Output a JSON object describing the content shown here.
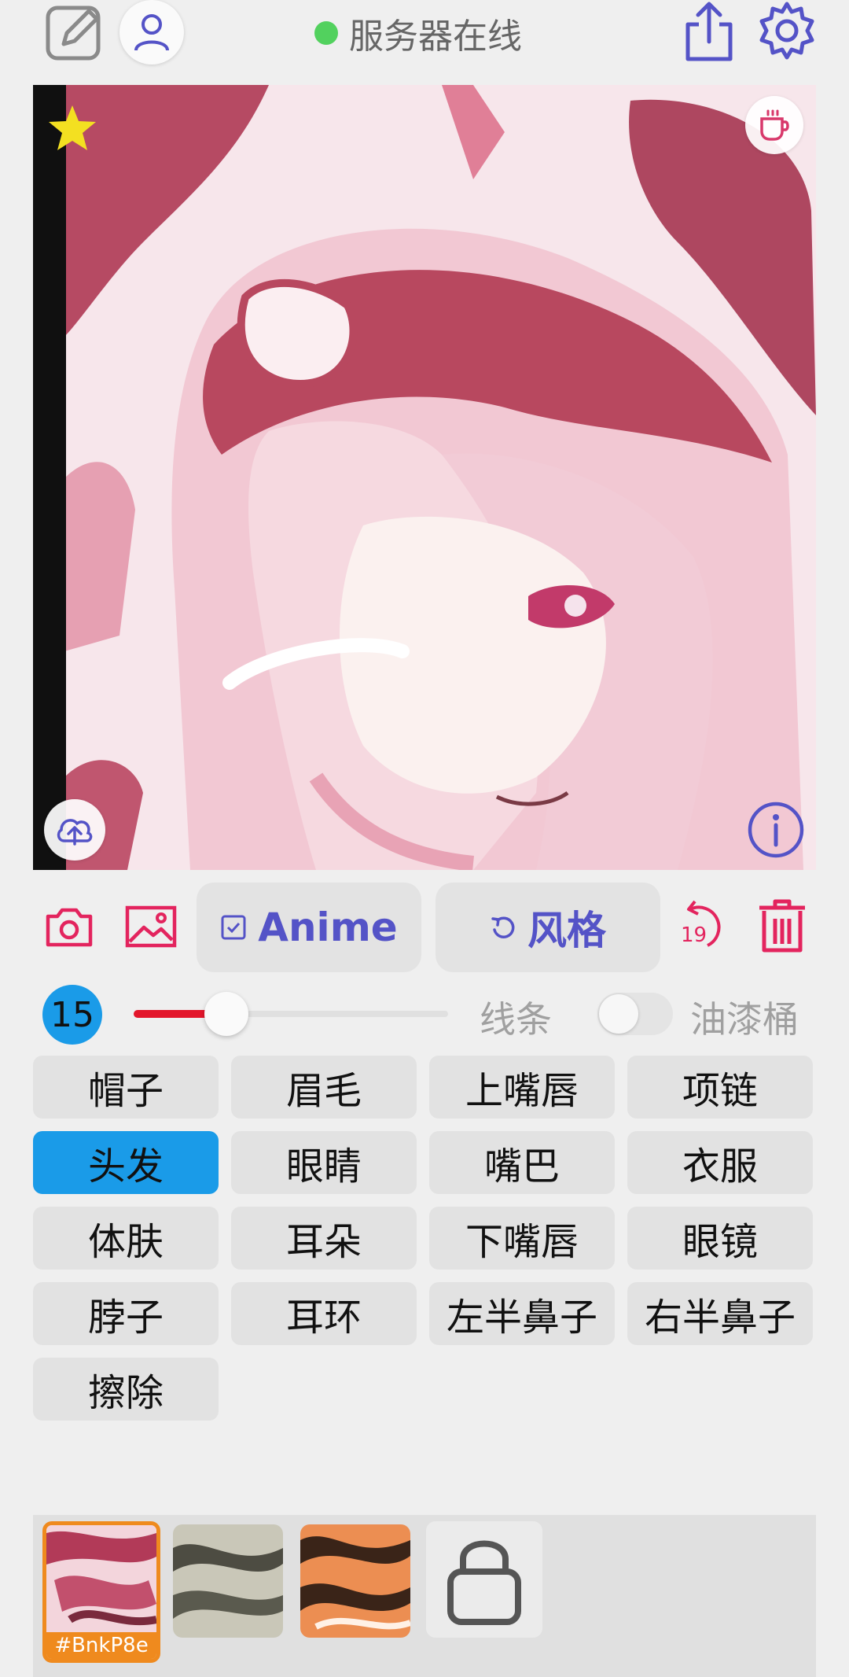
{
  "topbar": {
    "status_text": "服务器在线",
    "status_color": "#52d15e",
    "icons": [
      "edit-icon",
      "user-icon",
      "share-icon",
      "settings-icon"
    ]
  },
  "canvas": {
    "icons": [
      "star-icon",
      "coffee-cup-icon",
      "upload-cloud-icon",
      "info-icon"
    ]
  },
  "toolbar": {
    "icons": [
      "camera-icon",
      "image-icon",
      "undo-icon",
      "trash-icon"
    ],
    "anime_label": "Anime",
    "style_label": "风格",
    "undo_count": "19"
  },
  "brush": {
    "size": "15",
    "slider_fraction": 0.3,
    "line_label": "线条",
    "bucket_label": "油漆桶",
    "bucket_enabled": false
  },
  "parts": [
    {
      "label": "帽子"
    },
    {
      "label": "眉毛"
    },
    {
      "label": "上嘴唇"
    },
    {
      "label": "项链"
    },
    {
      "label": "头发",
      "selected": true
    },
    {
      "label": "眼睛"
    },
    {
      "label": "嘴巴"
    },
    {
      "label": "衣服"
    },
    {
      "label": "体肤"
    },
    {
      "label": "耳朵"
    },
    {
      "label": "下嘴唇"
    },
    {
      "label": "眼镜"
    },
    {
      "label": "脖子"
    },
    {
      "label": "耳环"
    },
    {
      "label": "左半鼻子"
    },
    {
      "label": "右半鼻子"
    },
    {
      "label": "擦除"
    }
  ],
  "styles": {
    "selected_code": "#BnkP8e",
    "icons": [
      "lock-icon"
    ]
  },
  "colors": {
    "accent": "#5453c7",
    "danger": "#e3162b",
    "selected": "#1a9be8",
    "thumb_selected": "#ef8a1e"
  }
}
